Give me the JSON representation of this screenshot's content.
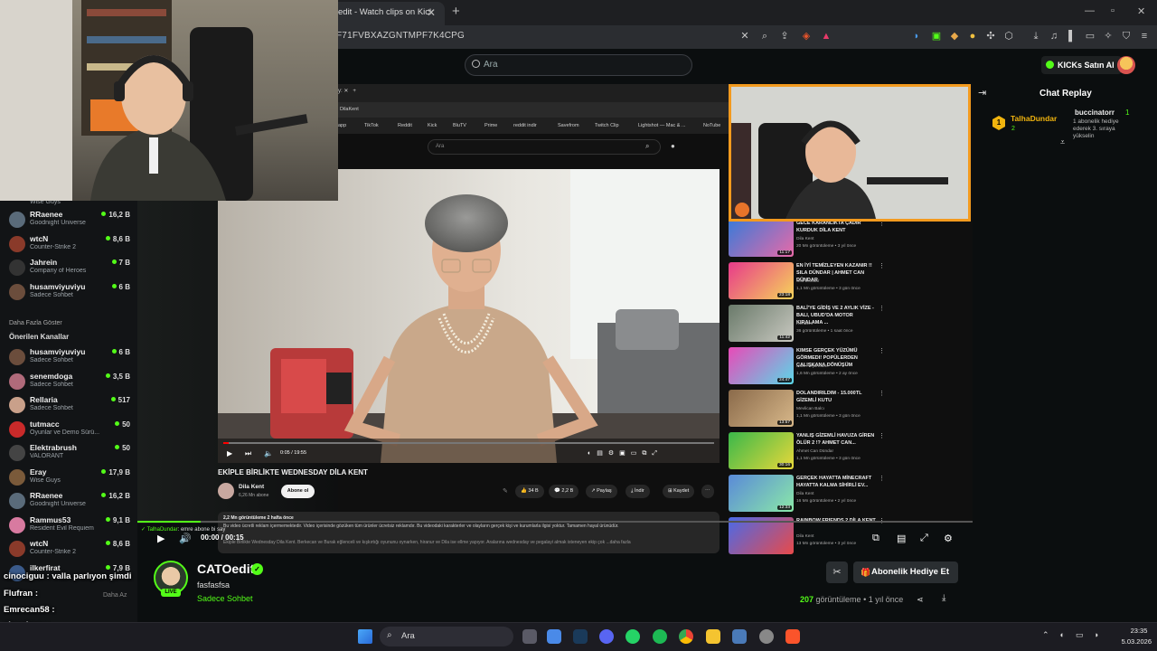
{
  "browser": {
    "tab_title": "edit - Watch clips on Kick",
    "tab_close": "✕",
    "new_tab": "+",
    "url": "F71FVBXAZGNTMPF7K4CPG"
  },
  "kick": {
    "search_placeholder": "Ara",
    "kicks_button": "KICKs Satın Al"
  },
  "sidebar": {
    "channels_top": [
      {
        "name": "RRaenee",
        "game": "Goodnight Universe",
        "count": "16,2 B",
        "color": "#5a6b7a"
      },
      {
        "name": "wtcN",
        "game": "Counter-Strike 2",
        "count": "8,6 B",
        "color": "#8a3a2a"
      },
      {
        "name": "Jahrein",
        "game": "Company of Heroes",
        "count": "7 B",
        "color": "#333"
      },
      {
        "name": "husamviyuviyu",
        "game": "Sadece Sohbet",
        "count": "6 B",
        "color": "#6b4d3c"
      }
    ],
    "partial_game": "Wise Guys",
    "more_link": "Daha Fazla Göster",
    "recommended_heading": "Önerilen Kanallar",
    "channels_recommended": [
      {
        "name": "husamviyuviyu",
        "game": "Sadece Sohbet",
        "count": "6 B",
        "color": "#6b4d3c"
      },
      {
        "name": "senemdoga",
        "game": "Sadece Sohbet",
        "count": "3,5 B",
        "color": "#b06a7a"
      },
      {
        "name": "Rellaria",
        "game": "Sadece Sohbet",
        "count": "517",
        "color": "#c9a08a"
      },
      {
        "name": "tutmacc",
        "game": "Oyunlar ve Demo Sürü...",
        "count": "50",
        "color": "#c92a2a"
      },
      {
        "name": "Elektrabrush",
        "game": "VALORANT",
        "count": "50",
        "color": "#444"
      },
      {
        "name": "Eray",
        "game": "Wise Guys",
        "count": "17,9 B",
        "color": "#7a5a3a"
      },
      {
        "name": "RRaenee",
        "game": "Goodnight Universe",
        "count": "16,2 B",
        "color": "#5a6b7a"
      },
      {
        "name": "Rammus53",
        "game": "Resident Evil Requiem",
        "count": "9,1 B",
        "color": "#d87aa0"
      },
      {
        "name": "wtcN",
        "game": "Counter-Strike 2",
        "count": "8,6 B",
        "color": "#8a3a2a"
      },
      {
        "name": "ilkerfirat",
        "game": "",
        "count": "7,9 B",
        "color": "#3a5a8a"
      }
    ],
    "less_link": "Daha Az"
  },
  "youtube": {
    "search_placeholder": "Ara",
    "bookmarks": [
      "DilaKent",
      "TikTok",
      "Reddit",
      "Kick",
      "BluTV",
      "Prime",
      "reddit indir",
      "Savefrom",
      "Twitch Clip",
      "Lightshot — Mac & ...",
      "NoTube"
    ],
    "bookmark_app": "app",
    "time": "0:05 / 19:55",
    "title": "EKİPLE BİRLİKTE WEDNESDAY DİLA KENT",
    "channel": "Dila Kent",
    "subs": "6,26 Mn abone",
    "subscribe": "Abone ol",
    "likes": "34 B",
    "comments": "2,2 B",
    "share": "Paylaş",
    "download": "İndir",
    "save": "Kaydet",
    "desc_meta": "2,2 Mn görüntüleme  2 hafta önce",
    "desc_line1": "Bu video ücretli reklam içermemektedir. Video içerisinde gözüken tüm ürünler ücretsiz reklamdır. Bu videodaki karakterler ve olayların gerçek kişi ve kurumlarla ilgisi yoktur. Tamamen hayal ürünüdür.",
    "desc_line2": "Ekiple Birlikte Wednesday Dila Kent. Berkecan ve Burak eğlenceli ve kışkırtığı oyununu oynarken, hiranur ve Dila ise ellme yapıyor. Aralarına wednesday ve pegalayi almak isteneyen ekip çok ...daha fazla",
    "recommended": [
      {
        "title": "GECE KARANLIKTA ÇADIR KURDUK DİLA KENT",
        "channel": "Dila Kent",
        "meta": "20 Mn görüntüleme • 3 yıl önce",
        "dur": "11:17",
        "c1": "#3a7ad8",
        "c2": "#e86aa8"
      },
      {
        "title": "EN İYİ TEMİZLEYEN KAZANIR !! Sıla Dündar | Ahmet Can Dündar",
        "channel": "Sıla Dündar",
        "meta": "1,1 Mn görüntüleme • 3 gün önce",
        "dur": "23:18",
        "c1": "#e83a8a",
        "c2": "#f6d45a"
      },
      {
        "title": "BALİ'YE GİDİŞ VE 2 AYLIK VİZE - Bali, Ubud'da Motor Kiralama ...",
        "channel": "Hendem",
        "meta": "36 görüntüleme • 1 saat önce",
        "dur": "11:42",
        "c1": "#6a7a6a",
        "c2": "#c8c8c0"
      },
      {
        "title": "Kimse Gerçek Yüzümü Görmedi! Popülerden Çalışkana Dönüşüm",
        "channel": "Hadi Heştireaber",
        "meta": "1,6 Mn görüntüleme • 2 ay önce",
        "dur": "24:47",
        "c1": "#e84ab8",
        "c2": "#5ad8e8"
      },
      {
        "title": "DOLANDIRILDIM - 15.000TL GİZEMLİ KUTU",
        "channel": "Mevlican Balcı",
        "meta": "1,1 Mn görüntüleme • 3 gün önce",
        "dur": "13:57",
        "c1": "#8a6a4a",
        "c2": "#d8b88a"
      },
      {
        "title": "YANLIŞ GİZEMLİ HAVUZA GİREN ÖLÜR 2 !? Ahmet Can...",
        "channel": "Ahmet Can Dündar",
        "meta": "1,1 Mn görüntüleme • 3 gün önce",
        "dur": "30:16",
        "c1": "#3ab84a",
        "c2": "#e8d83a"
      },
      {
        "title": "GERÇEK HAYATTA MİNECRAFT HAYATTA KALMA SİHİRLİ EV...",
        "channel": "Dila Kent",
        "meta": "16 Mn görüntüleme • 2 yıl önce",
        "dur": "12:33",
        "c1": "#5a8ad8",
        "c2": "#8ae8a8"
      },
      {
        "title": "RAINBOW FRIENDS 2 DİLA KENT",
        "channel": "Dila Kent",
        "meta": "13 Mn görüntüleme • 3 yıl önce",
        "dur": "",
        "c1": "#4a6ae8",
        "c2": "#e84a4a"
      }
    ]
  },
  "player": {
    "time": "00:00 / 00:15",
    "overlay_user": "TalhaDundar",
    "overlay_text": ": emre abone bi say"
  },
  "stream": {
    "name": "CATOedit",
    "title": "fasfasfsa",
    "category": "Sadece Sohbet",
    "live": "LIVE",
    "views_num": "207",
    "views_rest": " görüntüleme • 1 yıl önce",
    "gift_button": "Abonelik Hediye Et"
  },
  "chat": {
    "title": "Chat Replay",
    "gifter_rank": "1",
    "gifter_name": "TalhaDundar",
    "gifter_count": "2",
    "pinned_user": "buccinatorr",
    "pinned_count": "1",
    "pinned_msg": "1 abonelik hediye ederek 3. sıraya yükselin"
  },
  "overlay_chat": [
    {
      "user": "cinociguu",
      "text": " : valla parlıyon şimdi"
    },
    {
      "user": "Flufran",
      "text": " :"
    },
    {
      "user": "Emrecan58",
      "text": " :"
    },
    {
      "user": "cinociguu",
      "text": " :"
    },
    {
      "user": "",
      "text": ": bi daha dinlemek için açtırdı"
    }
  ],
  "taskbar": {
    "search": "Ara",
    "time": "23:35",
    "date": "5.03.2026"
  },
  "colors": {
    "accent": "#53fc18",
    "cam_border": "#f39a1e"
  }
}
